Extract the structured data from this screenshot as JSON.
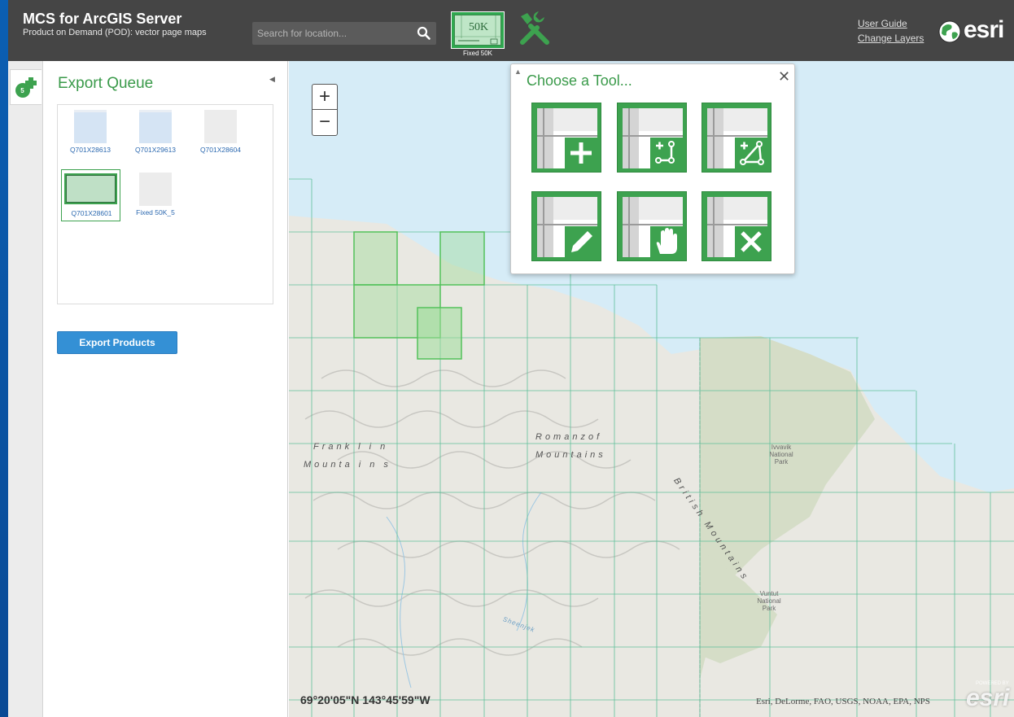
{
  "header": {
    "title": "MCS for ArcGIS Server",
    "subtitle": "Product on Demand (POD): vector page maps",
    "search_placeholder": "Search for location...",
    "product_caption": "Fixed 50K",
    "product_tile_text": "50K",
    "links": {
      "user_guide": "User Guide",
      "change_layers": "Change Layers"
    },
    "brand": "esri"
  },
  "rail": {
    "queue_count": "5"
  },
  "panel": {
    "title": "Export Queue",
    "items": [
      {
        "label": "Q701X28613",
        "thumb": "map"
      },
      {
        "label": "Q701X29613",
        "thumb": "map"
      },
      {
        "label": "Q701X28604",
        "thumb": "blank"
      },
      {
        "label": "Q701X28601",
        "thumb": "product"
      },
      {
        "label": "Fixed 50K_5",
        "thumb": "blank"
      }
    ],
    "export_button": "Export Products"
  },
  "popup": {
    "title": "Choose a Tool...",
    "close_glyph": "✕",
    "tools": [
      "add-icon",
      "add-rectangle-icon",
      "add-polygon-icon",
      "edit-icon",
      "pan-icon",
      "delete-icon"
    ]
  },
  "map": {
    "zoom_in": "+",
    "zoom_out": "−",
    "coordinates": "69°20'05\"N 143°45'59\"W",
    "attribution": "Esri, DeLorme, FAO, USGS, NOAA, EPA, NPS",
    "watermark": "esri",
    "powered_by": "POWERED BY",
    "labels": {
      "romanzof_1": "Romanzof",
      "romanzof_2": "Mountains",
      "franklin_1": "Frank l i n",
      "franklin_2": "Mounta i n s",
      "british": "British Mountains",
      "ivvavik": "Ivvavik National Park",
      "vuntut": "Vuntut National Park",
      "river": "Sheenjek"
    }
  },
  "colors": {
    "header_bg": "#454545",
    "accent_green": "#3da24f",
    "title_green": "#3a9a4a",
    "button_blue": "#3490d5",
    "ocean": "#d6ecf7",
    "land": "#e9e8e2",
    "park": "#d5ddc7",
    "grid": "#5fc09a"
  }
}
